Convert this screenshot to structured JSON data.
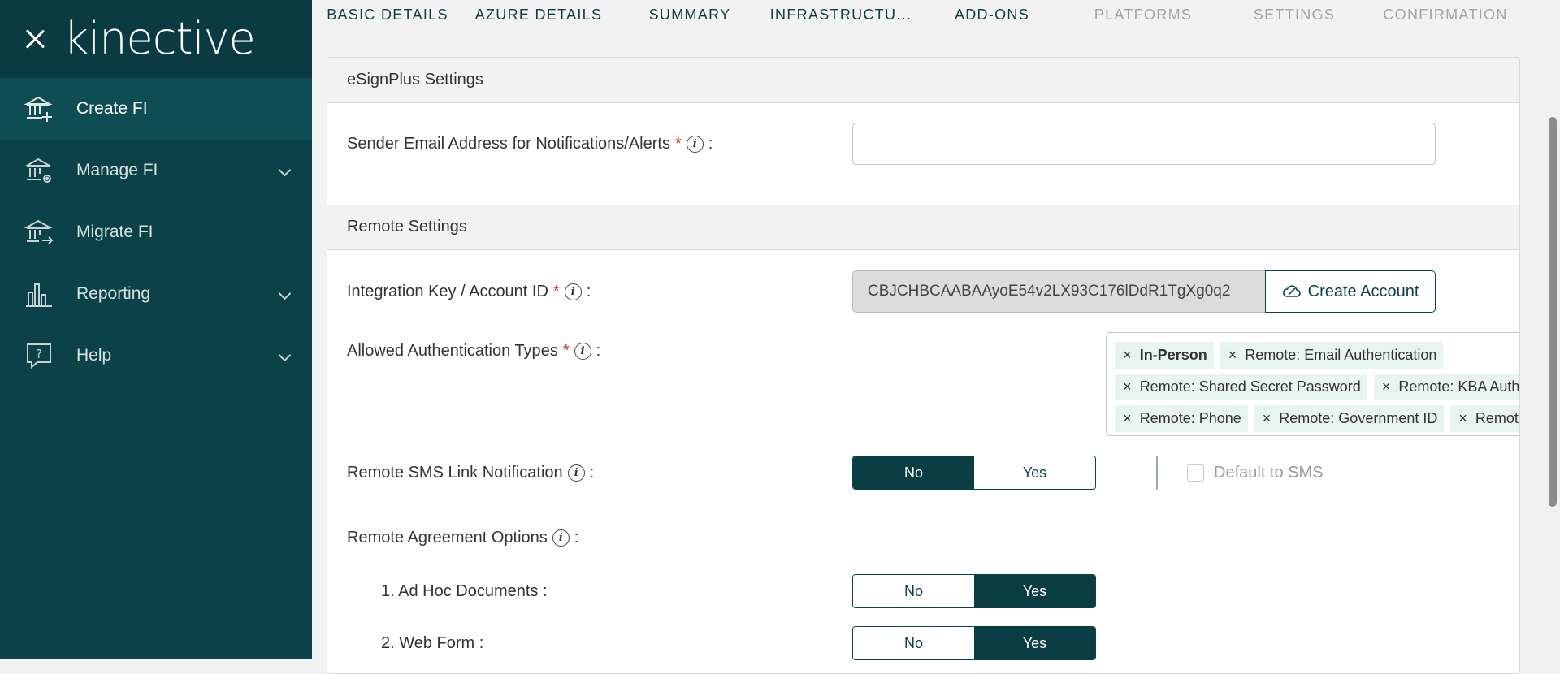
{
  "sidebar": {
    "logo": "kinective",
    "items": [
      {
        "label": "Create FI",
        "active": true
      },
      {
        "label": "Manage FI"
      },
      {
        "label": "Migrate FI"
      },
      {
        "label": "Reporting"
      },
      {
        "label": "Help"
      }
    ]
  },
  "steps": [
    {
      "label": "BASIC DETAILS",
      "state": "done"
    },
    {
      "label": "AZURE DETAILS",
      "state": "done"
    },
    {
      "label": "SUMMARY",
      "state": "done"
    },
    {
      "label": "INFRASTRUCTU...",
      "state": "done"
    },
    {
      "label": "ADD-ONS",
      "state": "current"
    },
    {
      "label": "PLATFORMS",
      "state": "disabled"
    },
    {
      "label": "SETTINGS",
      "state": "disabled"
    },
    {
      "label": "CONFIRMATION",
      "state": "disabled"
    }
  ],
  "esign": {
    "header": "eSignPlus Settings",
    "sender_label": "Sender Email Address for Notifications/Alerts",
    "sender_value": ""
  },
  "remote": {
    "header": "Remote Settings",
    "key_label": "Integration Key / Account ID",
    "key_value": "CBJCHBCAABAAyoE54v2LX93C176lDdR1TgXg0q2",
    "create_account": "Create Account",
    "auth_label": "Allowed Authentication Types",
    "auth_tags": [
      "In-Person",
      "Remote: Email Authentication",
      "Remote: Shared Secret Password",
      "Remote: KBA Authentication",
      "Remote: Phone",
      "Remote: Government ID",
      "Remote: ID.me"
    ],
    "sms_label": "Remote SMS Link Notification",
    "sms_no": "No",
    "sms_yes": "Yes",
    "default_sms": "Default to SMS",
    "agreement_label": "Remote Agreement Options",
    "adhoc_label": "1. Ad Hoc Documents :",
    "adhoc_no": "No",
    "adhoc_yes": "Yes",
    "webform_label": "2. Web Form :",
    "webform_no": "No",
    "webform_yes": "Yes"
  },
  "colors": {
    "sidebar": "#0b4249",
    "accent": "#0b3d44",
    "tag_bg": "#e8f4ef",
    "required": "#d0312d"
  },
  "icons": [
    "close-icon",
    "bank-plus-icon",
    "bank-gear-icon",
    "bank-arrow-icon",
    "bar-chart-icon",
    "help-bubble-icon",
    "chevron-down-icon",
    "info-icon",
    "cloud-link-icon",
    "dropdown-caret-icon"
  ]
}
